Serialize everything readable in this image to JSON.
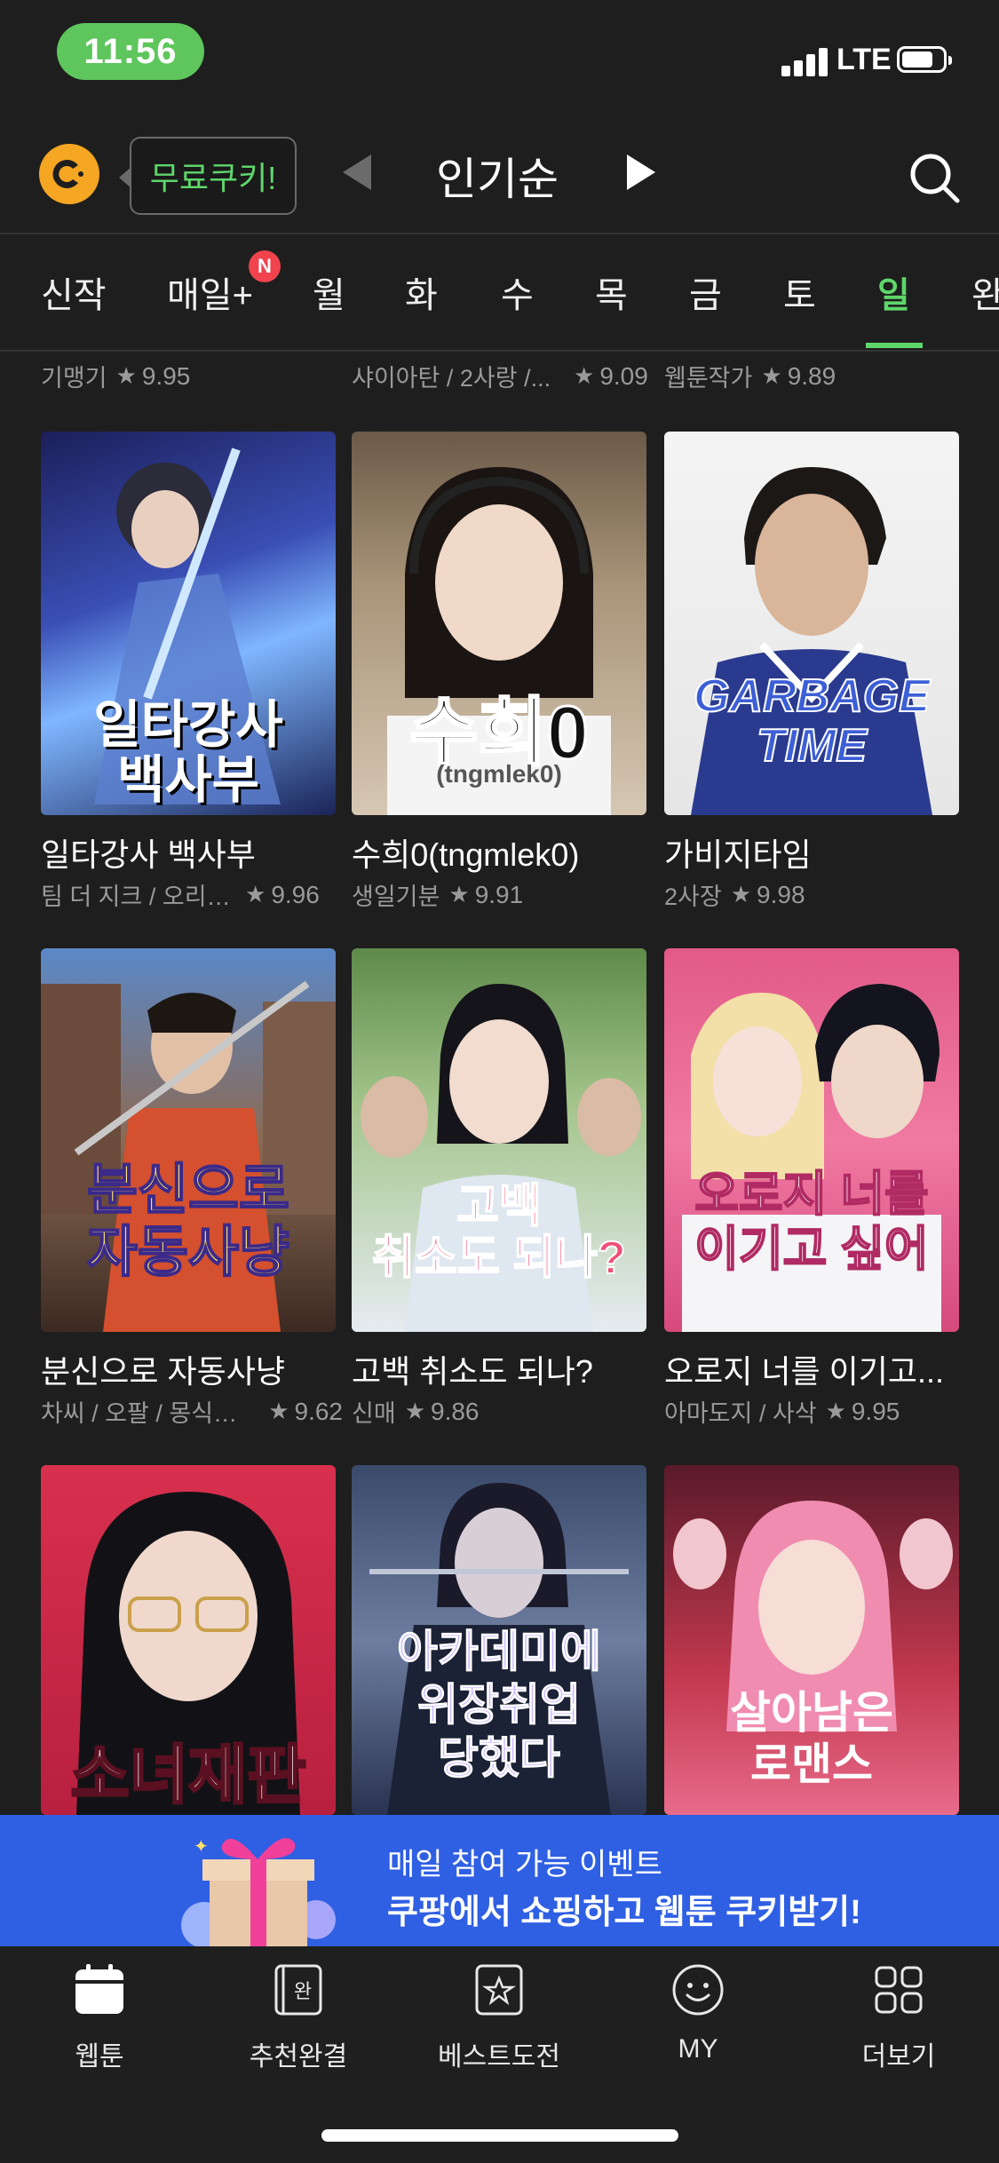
{
  "status_bar": {
    "time": "11:56",
    "network": "LTE"
  },
  "header": {
    "cookie_label": "무료쿠키!",
    "sort_title": "인기순",
    "icons": {
      "logo": "cookie-logo-icon",
      "prev": "triangle-left-icon",
      "next": "triangle-right-icon",
      "search": "search-icon"
    }
  },
  "day_tabs": {
    "items": [
      "신작",
      "매일+",
      "월",
      "화",
      "수",
      "목",
      "금",
      "토",
      "일",
      "완"
    ],
    "active": "일",
    "badge": "N"
  },
  "partial_row": [
    {
      "author": "기맹기",
      "rating": "9.95"
    },
    {
      "author": "샤이아탄 / 2사랑 /...",
      "rating": "9.09"
    },
    {
      "author": "웹툰작가",
      "rating": "9.89"
    }
  ],
  "rows": [
    [
      {
        "title": "일타강사 백사부",
        "author": "팀 더 지크 / 오리보…",
        "rating": "9.96",
        "cover_text": "일타강사\n백사부"
      },
      {
        "title": "수희0(tngmlek0)",
        "author": "생일기분",
        "rating": "9.91",
        "cover_text": "수희0",
        "cover_sub": "(tngmlek0)"
      },
      {
        "title": "가비지타임",
        "author": "2사장",
        "rating": "9.98",
        "cover_text": "GARBAGE TIME"
      }
    ],
    [
      {
        "title": "분신으로 자동사냥",
        "author": "차씨 / 오팔 / 몽식夢食",
        "rating": "9.62",
        "cover_text": "분신으로\n자동사냥"
      },
      {
        "title": "고백 취소도 되나?",
        "author": "신매",
        "rating": "9.86",
        "cover_text": "고백\n취소도 되나?"
      },
      {
        "title": "오로지 너를 이기고...",
        "author": "아마도지 / 사삭",
        "rating": "9.95",
        "cover_text": "오로지 너를\n이기고 싶어"
      }
    ],
    [
      {
        "cover_text": "소녀재판"
      },
      {
        "cover_text": "아카데미에\n위장취업\n당했다"
      },
      {
        "cover_text": "살아남은\n로맨스"
      }
    ]
  ],
  "banner": {
    "line1": "매일 참여 가능 이벤트",
    "line2": "쿠팡에서 쇼핑하고 웹툰 쿠키받기!",
    "icon": "gift-box-icon"
  },
  "bottom_nav": [
    {
      "label": "웹툰",
      "icon": "calendar-icon"
    },
    {
      "label": "추천완결",
      "icon": "book-complete-icon",
      "icon_text": "완"
    },
    {
      "label": "베스트도전",
      "icon": "star-book-icon"
    },
    {
      "label": "MY",
      "icon": "smiley-icon"
    },
    {
      "label": "더보기",
      "icon": "grid-icon"
    }
  ],
  "colors": {
    "accent": "#5ed66b",
    "background": "#1e1e1e",
    "banner": "#2f5fe3",
    "badge": "#f0434e"
  }
}
